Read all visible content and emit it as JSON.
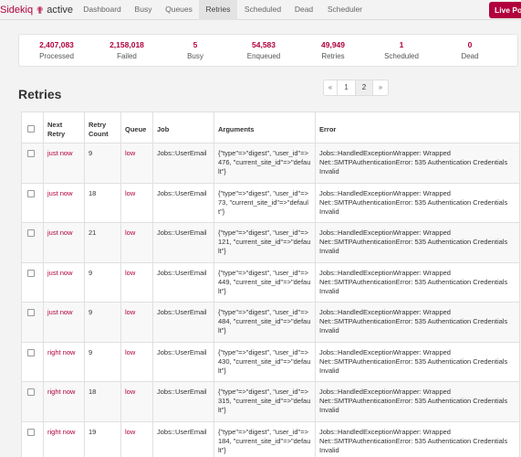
{
  "brand": {
    "name": "Sidekiq",
    "status": "active",
    "accent": "#b1003e"
  },
  "nav": {
    "tabs": [
      "Dashboard",
      "Busy",
      "Queues",
      "Retries",
      "Scheduled",
      "Dead",
      "Scheduler"
    ],
    "active": "Retries",
    "live_label": "Live Po"
  },
  "summary": [
    {
      "value": "2,407,083",
      "label": "Processed"
    },
    {
      "value": "2,158,018",
      "label": "Failed"
    },
    {
      "value": "5",
      "label": "Busy"
    },
    {
      "value": "54,583",
      "label": "Enqueued"
    },
    {
      "value": "49,949",
      "label": "Retries"
    },
    {
      "value": "1",
      "label": "Scheduled"
    },
    {
      "value": "0",
      "label": "Dead"
    }
  ],
  "page_title": "Retries",
  "pagination": {
    "prev": "«",
    "pages": [
      "1",
      "2"
    ],
    "current": "2",
    "next": "»"
  },
  "table": {
    "headers": [
      "",
      "Next Retry",
      "Retry Count",
      "Queue",
      "Job",
      "Arguments",
      "Error"
    ],
    "rows": [
      {
        "next_retry": "just now",
        "count": "9",
        "queue": "low",
        "job": "Jobs::UserEmail",
        "args": "{\"type\"=>\"digest\", \"user_id\"=>476, \"current_site_id\"=>\"default\"}",
        "error": "Jobs::HandledExceptionWrapper: Wrapped Net::SMTPAuthenticationError: 535 Authentication Credentials Invalid"
      },
      {
        "next_retry": "just now",
        "count": "18",
        "queue": "low",
        "job": "Jobs::UserEmail",
        "args": "{\"type\"=>\"digest\", \"user_id\"=>73, \"current_site_id\"=>\"default\"}",
        "error": "Jobs::HandledExceptionWrapper: Wrapped Net::SMTPAuthenticationError: 535 Authentication Credentials Invalid"
      },
      {
        "next_retry": "just now",
        "count": "21",
        "queue": "low",
        "job": "Jobs::UserEmail",
        "args": "{\"type\"=>\"digest\", \"user_id\"=>121, \"current_site_id\"=>\"default\"}",
        "error": "Jobs::HandledExceptionWrapper: Wrapped Net::SMTPAuthenticationError: 535 Authentication Credentials Invalid"
      },
      {
        "next_retry": "just now",
        "count": "9",
        "queue": "low",
        "job": "Jobs::UserEmail",
        "args": "{\"type\"=>\"digest\", \"user_id\"=>449, \"current_site_id\"=>\"default\"}",
        "error": "Jobs::HandledExceptionWrapper: Wrapped Net::SMTPAuthenticationError: 535 Authentication Credentials Invalid"
      },
      {
        "next_retry": "just now",
        "count": "9",
        "queue": "low",
        "job": "Jobs::UserEmail",
        "args": "{\"type\"=>\"digest\", \"user_id\"=>484, \"current_site_id\"=>\"default\"}",
        "error": "Jobs::HandledExceptionWrapper: Wrapped Net::SMTPAuthenticationError: 535 Authentication Credentials Invalid"
      },
      {
        "next_retry": "right now",
        "count": "9",
        "queue": "low",
        "job": "Jobs::UserEmail",
        "args": "{\"type\"=>\"digest\", \"user_id\"=>430, \"current_site_id\"=>\"default\"}",
        "error": "Jobs::HandledExceptionWrapper: Wrapped Net::SMTPAuthenticationError: 535 Authentication Credentials Invalid"
      },
      {
        "next_retry": "right now",
        "count": "18",
        "queue": "low",
        "job": "Jobs::UserEmail",
        "args": "{\"type\"=>\"digest\", \"user_id\"=>315, \"current_site_id\"=>\"default\"}",
        "error": "Jobs::HandledExceptionWrapper: Wrapped Net::SMTPAuthenticationError: 535 Authentication Credentials Invalid"
      },
      {
        "next_retry": "right now",
        "count": "19",
        "queue": "low",
        "job": "Jobs::UserEmail",
        "args": "{\"type\"=>\"digest\", \"user_id\"=>184, \"current_site_id\"=>\"default\"}",
        "error": "Jobs::HandledExceptionWrapper: Wrapped Net::SMTPAuthenticationError: 535 Authentication Credentials Invalid"
      }
    ]
  }
}
